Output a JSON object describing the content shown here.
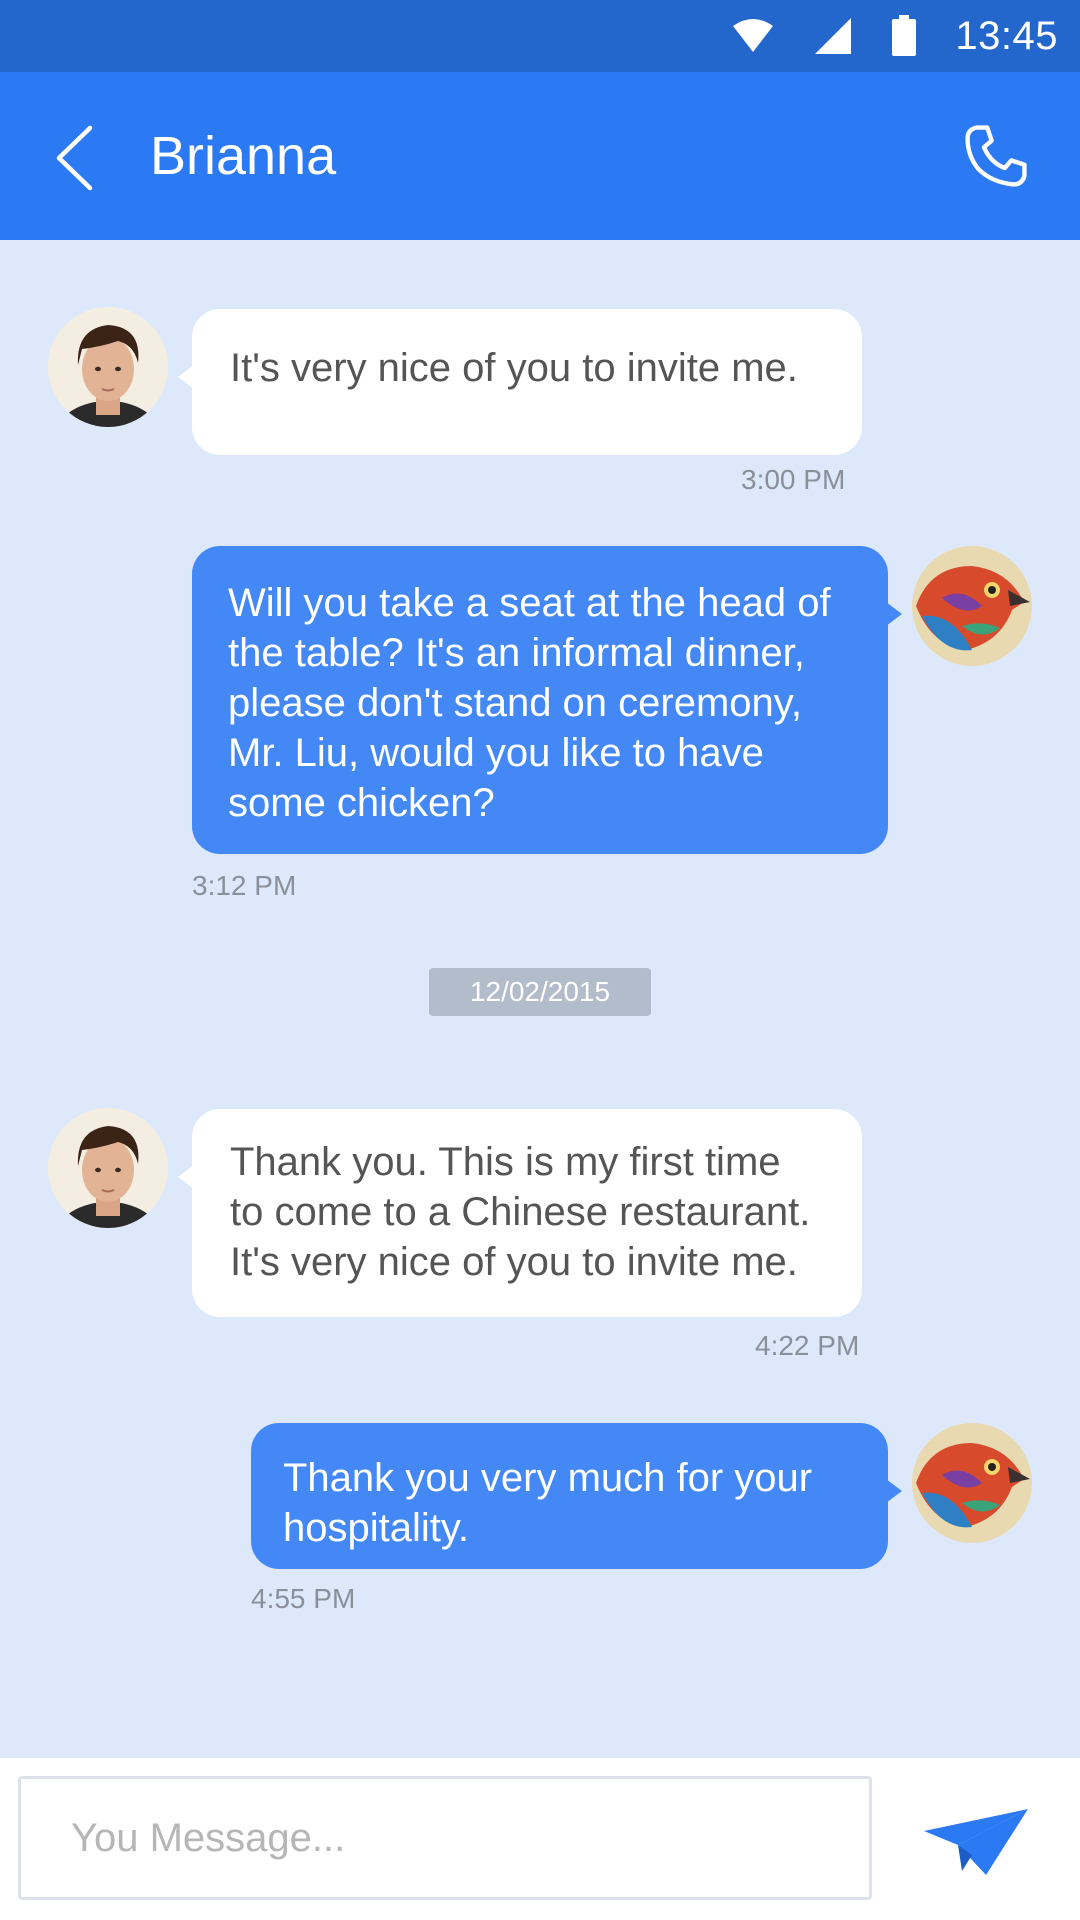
{
  "status_bar": {
    "time": "13:45",
    "icons": [
      "wifi-icon",
      "cell-signal-icon",
      "battery-icon"
    ]
  },
  "header": {
    "contact_name": "Brianna",
    "back_icon": "chevron-left-icon",
    "call_icon": "phone-icon"
  },
  "messages": [
    {
      "direction": "incoming",
      "text": "It's very nice of you to invite me.",
      "time": "3:00 PM"
    },
    {
      "direction": "outgoing",
      "text": "Will you take a seat at the head of\nthe table? It's an informal dinner,\nplease don't stand on ceremony,\nMr. Liu, would you like to have\nsome chicken?",
      "time": "3:12 PM"
    },
    {
      "direction": "incoming",
      "text": "Thank you. This is my first time\n to come to a Chinese restaurant.\nIt's very nice of you to invite me.",
      "time": "4:22 PM"
    },
    {
      "direction": "outgoing",
      "text": "Thank you very much for your\nhospitality.",
      "time": "4:55 PM"
    }
  ],
  "date_divider": "12/02/2015",
  "composer": {
    "placeholder": "You Message...",
    "value": "",
    "send_icon": "paper-plane-icon"
  },
  "colors": {
    "status_bar": "#2366cc",
    "header": "#2b79f3",
    "background": "#dde9fb",
    "outgoing_bubble": "#4488f5",
    "incoming_bubble": "#ffffff",
    "send_icon": "#2b79f3"
  }
}
